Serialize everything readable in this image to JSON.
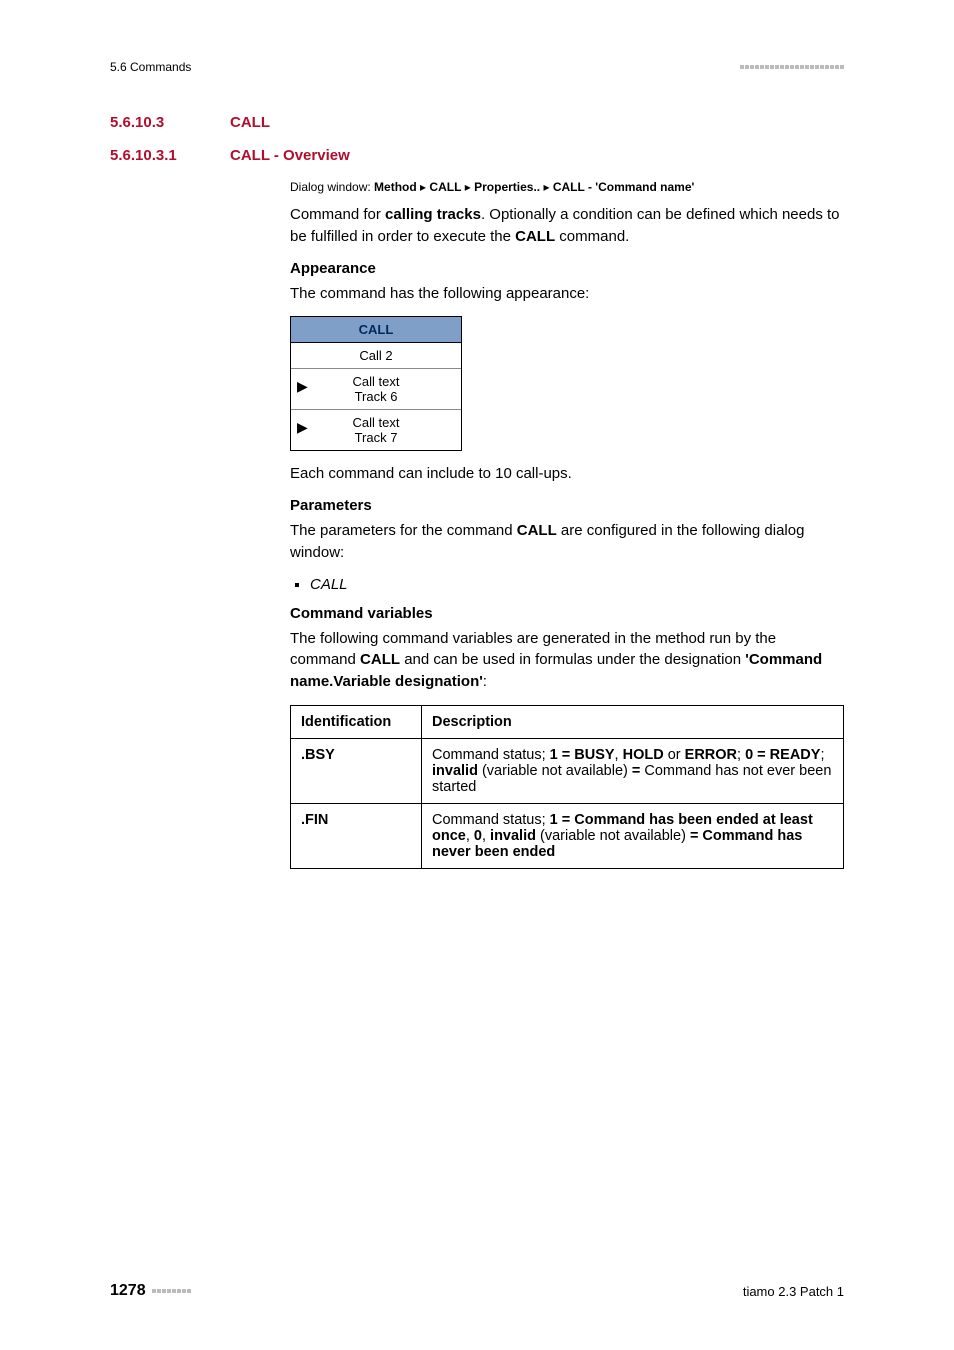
{
  "header": {
    "section": "5.6 Commands"
  },
  "sec1": {
    "num": "5.6.10.3",
    "title": "CALL"
  },
  "sec2": {
    "num": "5.6.10.3.1",
    "title": "CALL - Overview"
  },
  "dialog": {
    "prefix": "Dialog window: ",
    "p1": "Method",
    "p2": "CALL",
    "p3": "Properties..",
    "p4": "CALL - 'Command name'"
  },
  "intro": {
    "t1": "Command for ",
    "b1": "calling tracks",
    "t2": ". Optionally a condition can be defined which needs to be fulfilled in order to execute the ",
    "b2": "CALL",
    "t3": " command."
  },
  "appearance": {
    "head": "Appearance",
    "line": "The command has the following appearance:"
  },
  "callbox": {
    "header": "CALL",
    "r1": "Call 2",
    "r2a": "Call text",
    "r2b": "Track 6",
    "r3a": "Call text",
    "r3b": "Track 7"
  },
  "note1": "Each command can include to 10 call-ups.",
  "params": {
    "head": "Parameters",
    "t1": "The parameters for the command ",
    "b1": "CALL",
    "t2": " are configured in the following dialog window:",
    "item": "CALL"
  },
  "cmdvars": {
    "head": "Command variables",
    "t1": "The following command variables are generated in the method run by the command ",
    "b1": "CALL",
    "t2": " and can be used in formulas under the designation ",
    "b2": "'Command name.Variable designation'",
    "t3": ":"
  },
  "table": {
    "h1": "Identification",
    "h2": "Description",
    "r1c1": ".BSY",
    "r1": {
      "a": "Command status; ",
      "b1": "1 = BUSY",
      "c": ", ",
      "b2": "HOLD",
      "d": " or ",
      "b3": "ERROR",
      "e": "; ",
      "b4": "0 = READY",
      "f": "; ",
      "b5": "invalid",
      "g": " (variable not available) ",
      "b6": "=",
      "h": " Command has not ever been started"
    },
    "r2c1": ".FIN",
    "r2": {
      "a": "Command status; ",
      "b1": "1 = Command has been ended at least once",
      "c": ", ",
      "b2": "0",
      "d": ", ",
      "b3": "invalid",
      "e": " (variable not available) ",
      "b4": "= Command has never been ended"
    }
  },
  "footer": {
    "page": "1278",
    "version": "tiamo 2.3 Patch 1"
  }
}
